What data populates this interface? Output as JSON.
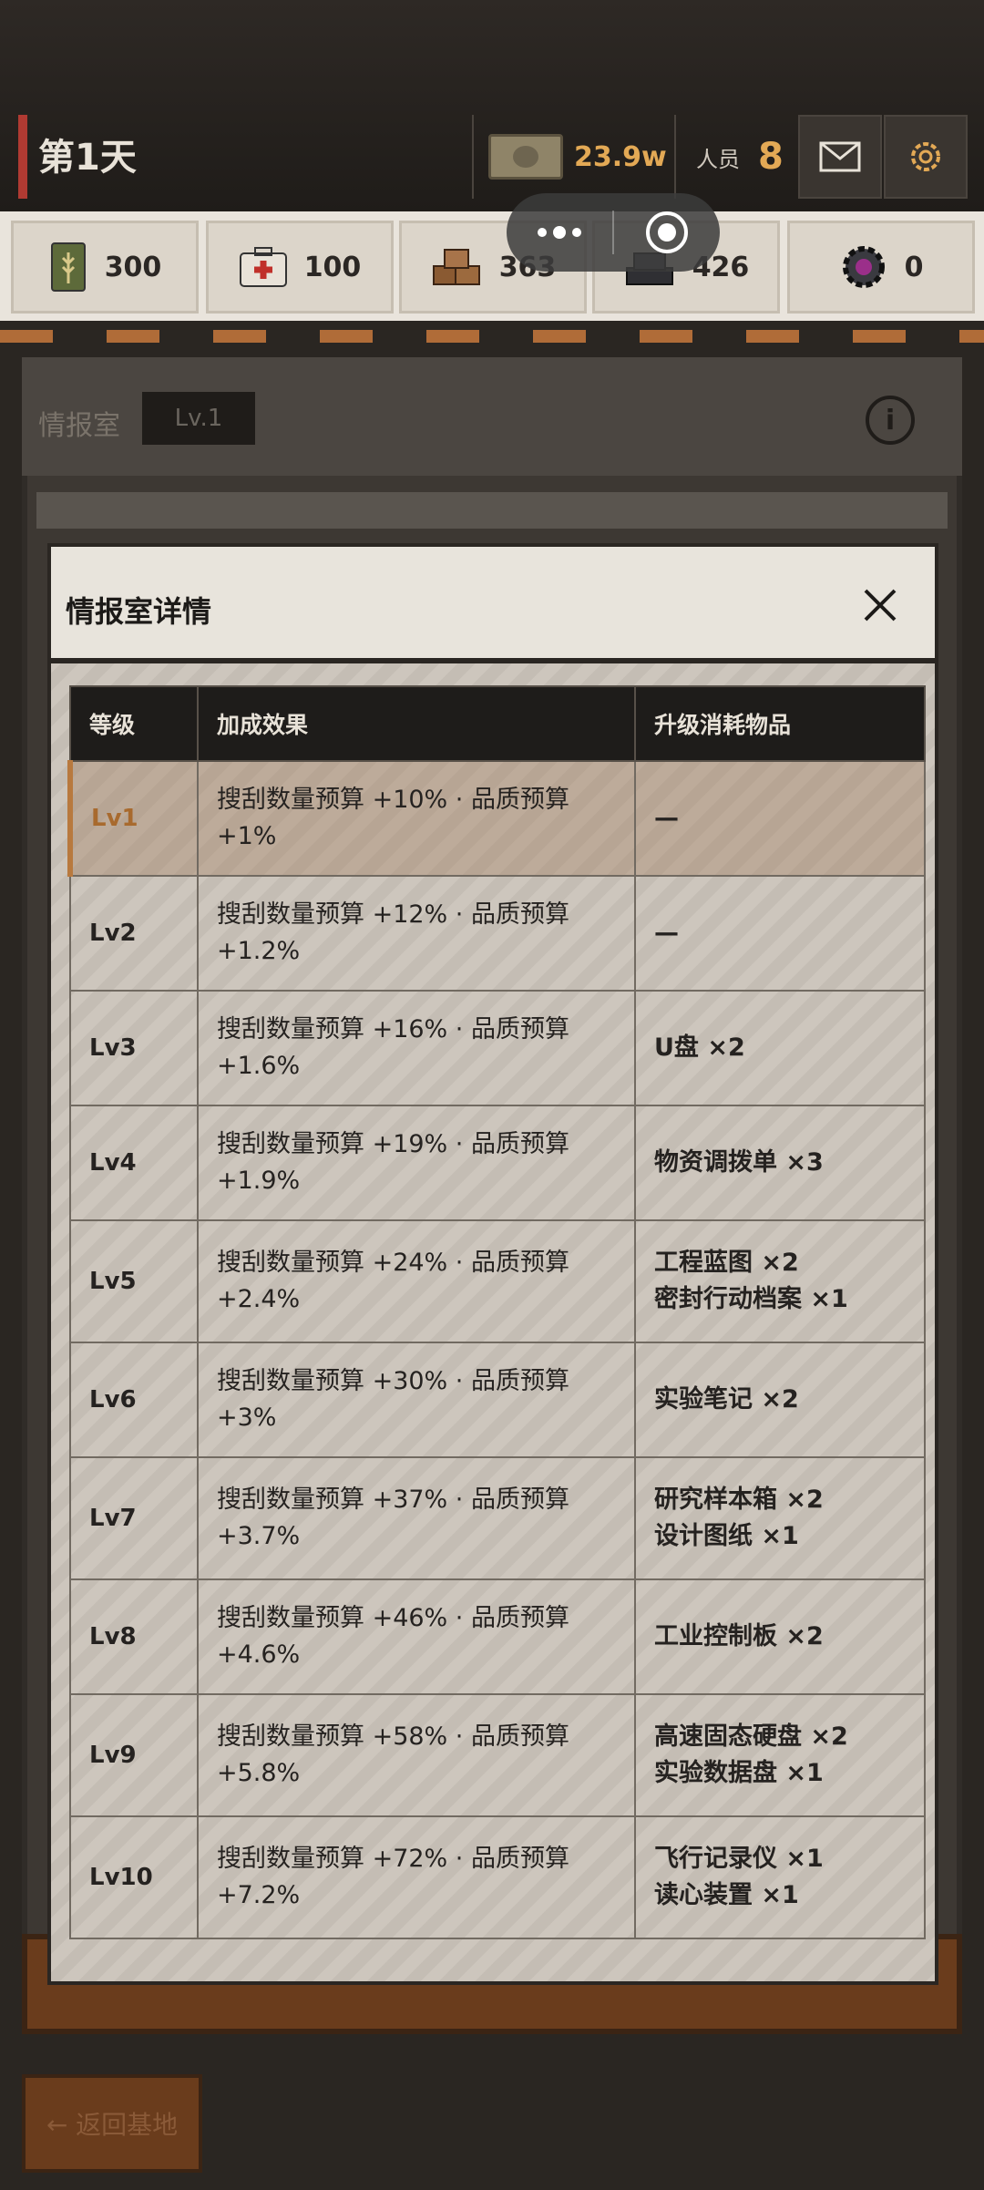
{
  "header": {
    "day_title": "第1天",
    "money": "23.9w",
    "staff_label": "人员",
    "staff_count": "8"
  },
  "resources": [
    {
      "icon": "food-can-icon",
      "value": "300"
    },
    {
      "icon": "medkit-icon",
      "value": "100"
    },
    {
      "icon": "wood-icon",
      "value": "363"
    },
    {
      "icon": "metal-icon",
      "value": "426"
    },
    {
      "icon": "gear-part-icon",
      "value": "0"
    }
  ],
  "background": {
    "room_title": "情报室",
    "room_level": "Lv.1"
  },
  "modal": {
    "title": "情报室详情",
    "columns": [
      "等级",
      "加成效果",
      "升级消耗物品"
    ],
    "rows": [
      {
        "level": "Lv1",
        "effect": "搜刮数量预算 +10% · 品质预算 +1%",
        "cost": [
          "—"
        ]
      },
      {
        "level": "Lv2",
        "effect": "搜刮数量预算 +12% · 品质预算 +1.2%",
        "cost": [
          "—"
        ]
      },
      {
        "level": "Lv3",
        "effect": "搜刮数量预算 +16% · 品质预算 +1.6%",
        "cost": [
          "U盘 ×2"
        ]
      },
      {
        "level": "Lv4",
        "effect": "搜刮数量预算 +19% · 品质预算 +1.9%",
        "cost": [
          "物资调拨单 ×3"
        ]
      },
      {
        "level": "Lv5",
        "effect": "搜刮数量预算 +24% · 品质预算 +2.4%",
        "cost": [
          "工程蓝图 ×2",
          "密封行动档案 ×1"
        ]
      },
      {
        "level": "Lv6",
        "effect": "搜刮数量预算 +30% · 品质预算 +3%",
        "cost": [
          "实验笔记 ×2"
        ]
      },
      {
        "level": "Lv7",
        "effect": "搜刮数量预算 +37% · 品质预算 +3.7%",
        "cost": [
          "研究样本箱 ×2",
          "设计图纸 ×1"
        ]
      },
      {
        "level": "Lv8",
        "effect": "搜刮数量预算 +46% · 品质预算 +4.6%",
        "cost": [
          "工业控制板 ×2"
        ]
      },
      {
        "level": "Lv9",
        "effect": "搜刮数量预算 +58% · 品质预算 +5.8%",
        "cost": [
          "高速固态硬盘 ×2",
          "实验数据盘 ×1"
        ]
      },
      {
        "level": "Lv10",
        "effect": "搜刮数量预算 +72% · 品质预算 +7.2%",
        "cost": [
          "飞行记录仪 ×1",
          "读心装置 ×1"
        ]
      }
    ],
    "current_level": "Lv1"
  },
  "footer": {
    "back_label": "← 返回基地"
  },
  "colors": {
    "accent_gold": "#e3a955",
    "danger_red": "#b03a32",
    "current_row": "#a86a2e"
  }
}
